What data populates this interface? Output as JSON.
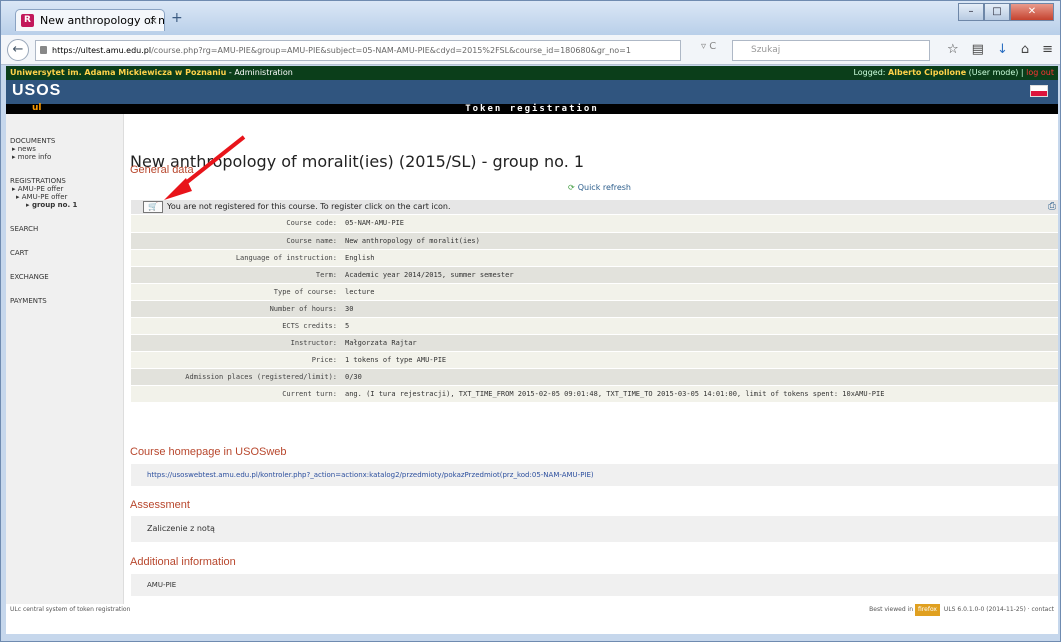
{
  "browser": {
    "tab_title": "New anthropology of mor...",
    "tab_favicon": "R",
    "tab_close": "×",
    "new_tab": "+",
    "url_domain": "https://ultest.amu.edu.pl",
    "url_rest": "/course.php?rg=AMU-PIE&group=AMU-PIE&subject=05-NAM-AMU-PIE&cdyd=2015%2FSL&course_id=180680&gr_no=1",
    "search_placeholder": "Szukaj"
  },
  "header": {
    "university": "Uniwersytet im. Adama Mickiewicza w Poznaniu",
    "admin": " - Administration",
    "logged_prefix": "Logged: ",
    "user": "Alberto Cipollone",
    "mode": " (User mode) | ",
    "logout": "log out",
    "logo": "USOS",
    "logo_sub": "ul",
    "page_title": "Token registration"
  },
  "sidebar": {
    "documents": "DOCUMENTS",
    "news": "▸ news",
    "more_info": "▸ more info",
    "registrations": "REGISTRATIONS",
    "offer1": "▸ AMU-PE offer",
    "offer2": "▸ AMU-PE offer",
    "group": "▸ group no. 1",
    "search": "SEARCH",
    "cart": "CART",
    "exchange": "EXCHANGE",
    "payments": "PAYMENTS"
  },
  "main": {
    "title": "New anthropology of moralit(ies) (2015/SL) - group no. 1",
    "general_data": "General data",
    "quick_refresh": "Quick refresh",
    "notice": "You are not registered for this course. To register click on the cart icon.",
    "rows": [
      {
        "k": "Course code:",
        "v": "05-NAM-AMU-PIE"
      },
      {
        "k": "Course name:",
        "v": "New anthropology of moralit(ies)"
      },
      {
        "k": "Language of instruction:",
        "v": "English"
      },
      {
        "k": "Term:",
        "v": "Academic year 2014/2015, summer semester"
      },
      {
        "k": "Type of course:",
        "v": "lecture"
      },
      {
        "k": "Number of hours:",
        "v": "30"
      },
      {
        "k": "ECTS credits:",
        "v": "5"
      },
      {
        "k": "Instructor:",
        "v": "Małgorzata Rajtar"
      },
      {
        "k": "Price:",
        "v": "1 tokens of type AMU-PIE"
      },
      {
        "k": "Admission places (registered/limit):",
        "v": "0/30"
      },
      {
        "k": "Current turn:",
        "v": "ang. (I tura rejestracji), TXT_TIME_FROM 2015-02-05 09:01:48, TXT_TIME_TO 2015-03-05 14:01:00, limit of tokens spent: 10xAMU-PIE"
      }
    ],
    "homepage_title": "Course homepage in USOSweb",
    "homepage_link": "https://usoswebtest.amu.edu.pl/kontroler.php?_action=actionx:katalog2/przedmioty/pokazPrzedmiot(prz_kod:05-NAM-AMU-PIE)",
    "assessment_title": "Assessment",
    "assessment_text": "Zaliczenie z notą",
    "additional_title": "Additional information",
    "additional_text": "AMU-PIE"
  },
  "footer": {
    "left": "ULc central system of token registration",
    "best_viewed": "Best viewed in",
    "browser_name": "firefox",
    "version": "ULS 6.0.1.0-0 (2014-11-25)",
    "contact": "contact"
  }
}
